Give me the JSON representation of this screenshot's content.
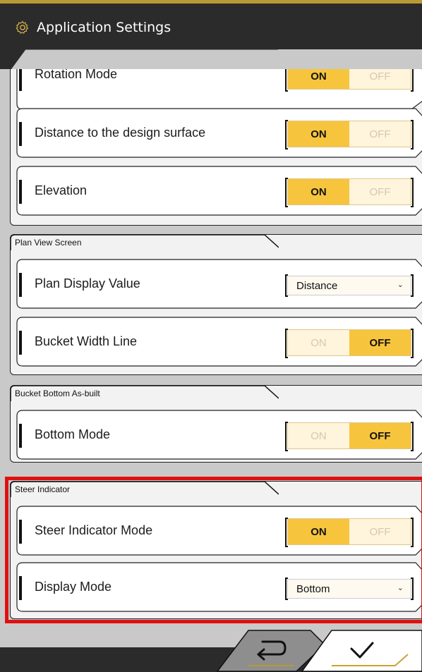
{
  "header": {
    "title": "Application Settings",
    "icon": "gear-icon"
  },
  "colors": {
    "accent": "#f7c53d",
    "header_bg": "#2b2b2b",
    "highlight": "#e01010",
    "inactive_bg": "#fff4dc"
  },
  "group1": {
    "rows": [
      {
        "label": "Rotation Mode",
        "on": "ON",
        "off": "OFF",
        "value": "ON"
      },
      {
        "label": "Distance to the design surface",
        "on": "ON",
        "off": "OFF",
        "value": "ON"
      },
      {
        "label": "Elevation",
        "on": "ON",
        "off": "OFF",
        "value": "ON"
      }
    ]
  },
  "plan_view": {
    "title": "Plan View Screen",
    "display_value": {
      "label": "Plan Display Value",
      "selected": "Distance"
    },
    "bucket_width": {
      "label": "Bucket Width Line",
      "on": "ON",
      "off": "OFF",
      "value": "OFF"
    }
  },
  "bucket_bottom": {
    "title": "Bucket Bottom As-built",
    "bottom_mode": {
      "label": "Bottom Mode",
      "on": "ON",
      "off": "OFF",
      "value": "OFF"
    }
  },
  "steer": {
    "title": "Steer Indicator",
    "mode": {
      "label": "Steer Indicator Mode",
      "on": "ON",
      "off": "OFF",
      "value": "ON"
    },
    "display": {
      "label": "Display Mode",
      "selected": "Bottom"
    }
  },
  "footer": {
    "back_icon": "return-icon",
    "confirm_icon": "checkmark-icon"
  }
}
